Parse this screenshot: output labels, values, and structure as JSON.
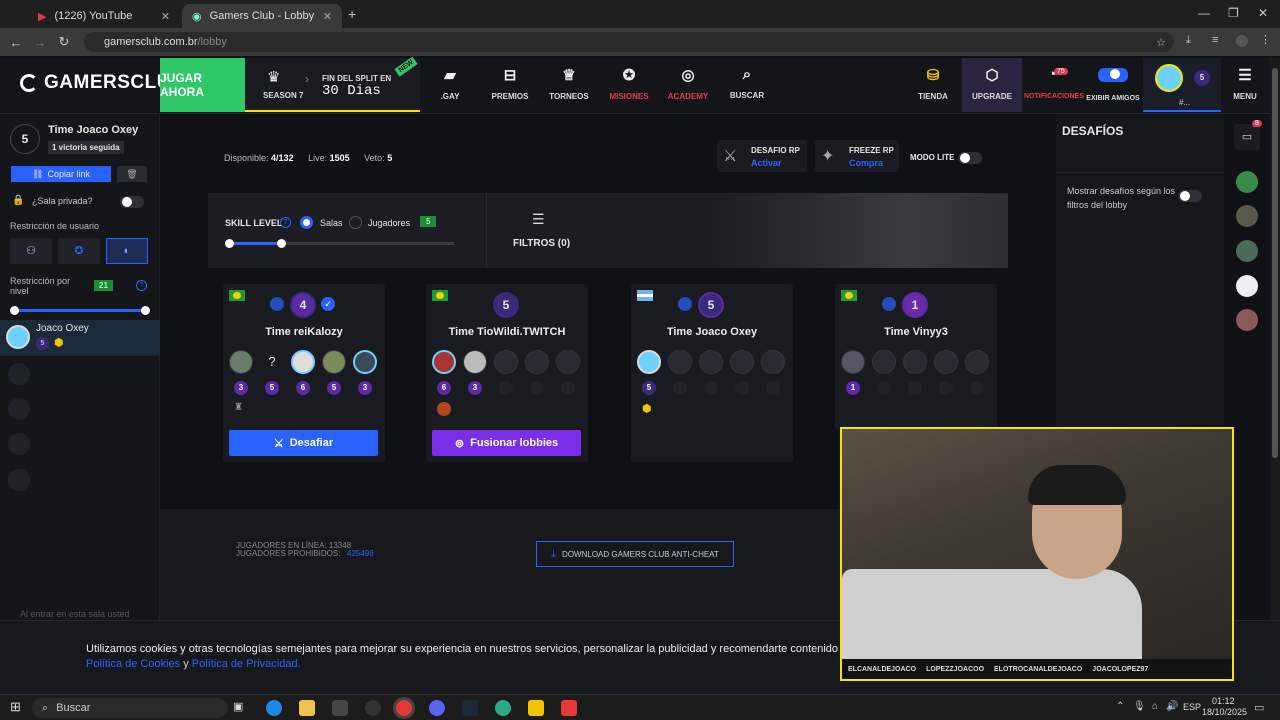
{
  "browser": {
    "tabs": [
      {
        "label": "(1226) YouTube"
      },
      {
        "label": "Gamers Club - Lobby Counter-Str"
      }
    ],
    "url_domain": "gamersclub.com.br",
    "url_path": "/lobby"
  },
  "header": {
    "logo": "GAMERSCLUB",
    "play_label": "JUGAR AHORA",
    "season_label": "SEASON 7",
    "new_badge": "NEW",
    "split_label": "FIN DEL SPLIT EN",
    "split_time": "30 Dias",
    "nav": [
      {
        "label": ".GAY",
        "icon": "chat-icon"
      },
      {
        "label": "PREMIOS",
        "icon": "ticket-icon"
      },
      {
        "label": "TORNEOS",
        "icon": "trophy-icon"
      },
      {
        "label": "MISIONES",
        "icon": "missions-icon"
      },
      {
        "label": "ACADEMY",
        "icon": "academy-icon"
      },
      {
        "label": "BUSCAR",
        "icon": "search-icon"
      },
      {
        "label": "TIENDA",
        "icon": "shop-icon"
      },
      {
        "label": "UPGRADE",
        "icon": "upgrade-icon"
      },
      {
        "label": "NOTIFICACIONES",
        "icon": "bell-icon"
      },
      {
        "label": "EXIBIR AMIGOS",
        "icon": "toggle-icon"
      },
      {
        "label": "MENU",
        "icon": "menu-icon"
      }
    ],
    "notif_count": "75",
    "user_level": "5",
    "user_tag": "#..."
  },
  "sidebar": {
    "lobby_level": "5",
    "lobby_name": "Time Joaco Oxey",
    "streak": "1 victoria seguida",
    "copy_link": "Copiar link",
    "private_label": "¿Sala privada?",
    "restriction_user": "Restricción de usuario",
    "restriction_level": "Restricción por nivel",
    "restriction_badge": "21",
    "member_name": "Joaco Oxey",
    "member_level": "5",
    "footer_note": "Al entrar en esta sala usted"
  },
  "main": {
    "stats": {
      "available_label": "Disponible:",
      "available_value": "4/132",
      "live_label": "Live:",
      "live_value": "1505",
      "veto_label": "Veto:",
      "veto_value": "5"
    },
    "challenge_rp": {
      "title": "DESAFIO RP",
      "action": "Activar"
    },
    "freeze_rp": {
      "title": "FREEZE RP",
      "action": "Compra"
    },
    "lite_mode": "MODO LITE",
    "skill_level": "SKILL LEVEL",
    "rooms_label": "Salas",
    "players_label": "Jugadores",
    "skill_badge": "5",
    "filters_label": "FILTROS (0)",
    "lobbies": [
      {
        "name": "Time reiKalozy",
        "level": "4",
        "levels": [
          "3",
          "5",
          "6",
          "5",
          "3"
        ],
        "button": "Desafiar"
      },
      {
        "name": "Time TioWildi.TWITCH",
        "level": "5",
        "levels": [
          "6",
          "3"
        ],
        "button": "Fusionar lobbies"
      },
      {
        "name": "Time Joaco Oxey",
        "level": "5",
        "levels": [
          "5"
        ],
        "button": ""
      },
      {
        "name": "Time Vinyy3",
        "level": "1",
        "levels": [
          "1"
        ],
        "button": ""
      }
    ],
    "footer": {
      "online": "JUGADORES EN LÍNEA: 13348",
      "banned_label": "JUGADORES PROHIBIDOS:",
      "banned_value": "425498",
      "anticheat": "DOWNLOAD GAMERS CLUB ANTI-CHEAT"
    }
  },
  "right": {
    "title": "DESAFÍOS",
    "filter_text": "Mostrar desafíos según los filtros del lobby",
    "chat_badge": "8"
  },
  "cookie": {
    "text": "Utilizamos cookies y otras tecnologías semejantes para mejorar su experiencia en nuestros servicios, personalizar la publicidad y recomendarte contenido de tu i",
    "link1": "Política de Cookies",
    "and": "y",
    "link2": "Política de Privacidad."
  },
  "webcam": {
    "tags": [
      "ELCANALDEJOACO",
      "LOPEZZJOACOO",
      "ELOTROCANALDEJOACO",
      "JOACOLOPEZ97"
    ]
  },
  "taskbar": {
    "search": "Buscar",
    "lang": "ESP",
    "time": "01:12",
    "date": "18/10/2025"
  }
}
